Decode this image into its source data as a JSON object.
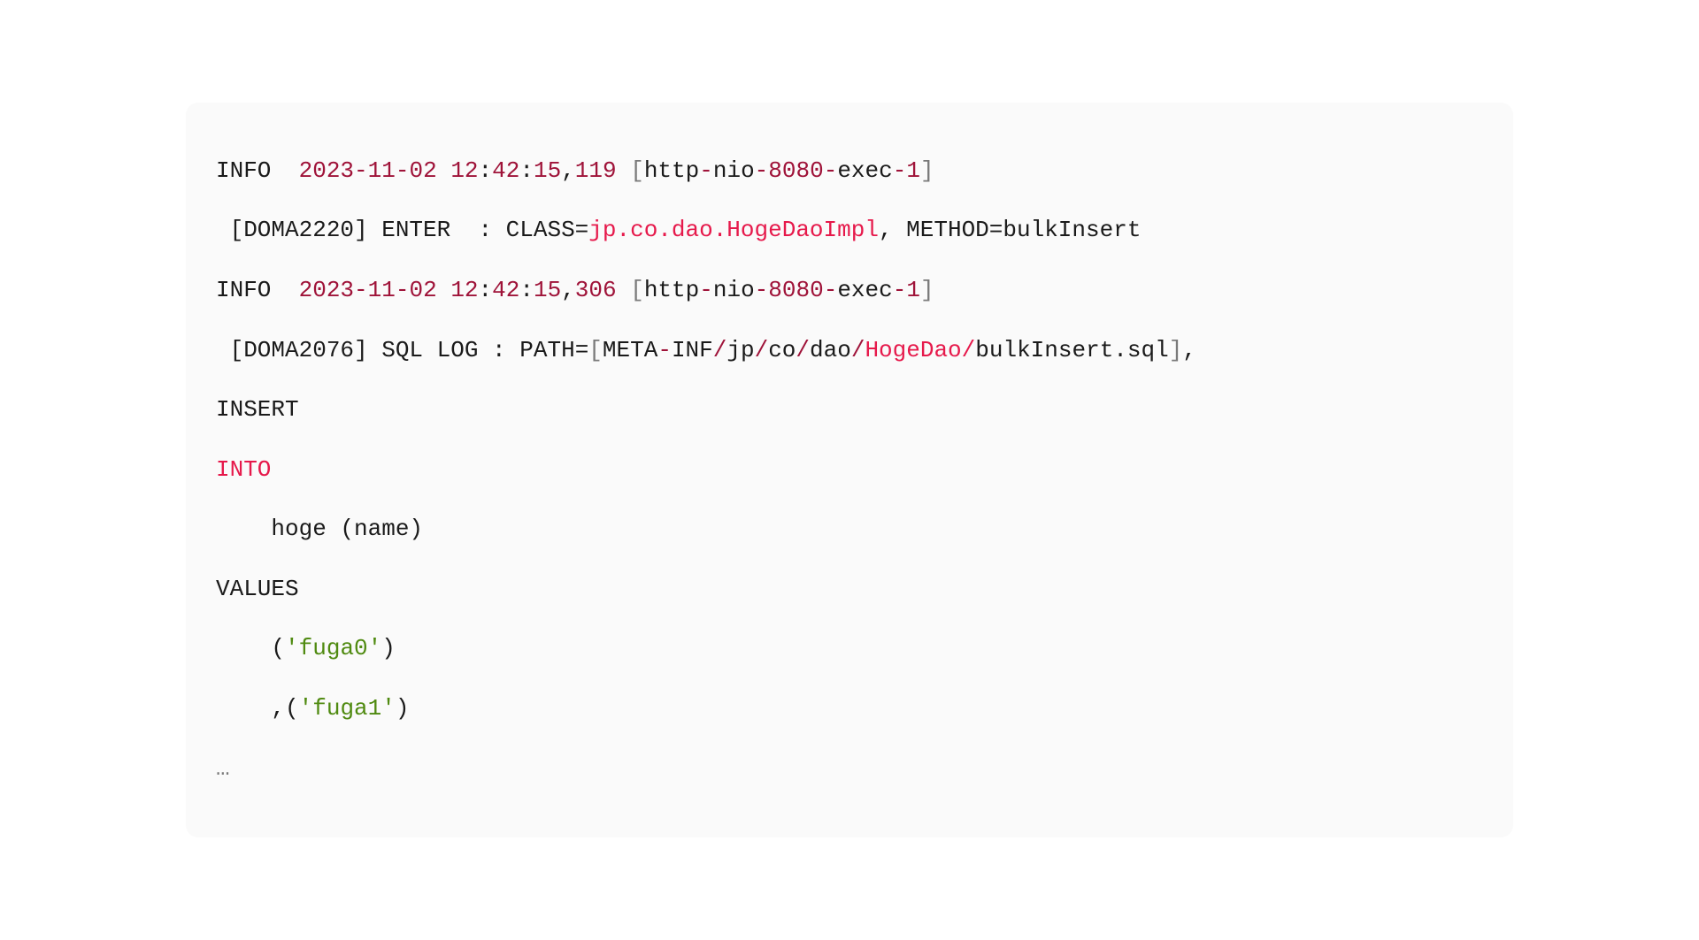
{
  "log": {
    "line1": {
      "level": "INFO  ",
      "date": "2023",
      "dash1": "-",
      "mon": "11",
      "dash2": "-",
      "day": "02",
      "sp1": " ",
      "hh": "12",
      "colon1": ":",
      "mm": "42",
      "colon2": ":",
      "ss": "15",
      "comma": ",",
      "ms": "119",
      "sp2": " ",
      "lb": "[",
      "thr1": "http",
      "thr_dash1": "-",
      "thr2": "nio",
      "thr_dash2": "-",
      "thr_port": "8080",
      "thr_dash3": "-",
      "thr3": "exec",
      "thr_dash4": "-",
      "thr_n": "1",
      "rb": "]"
    },
    "line2": {
      "pre": " [DOMA2220] ENTER  : ",
      "class_label": "CLASS",
      "eq1": "=",
      "class_val": "jp.co.dao.HogeDaoImpl",
      "comma": ", ",
      "method_label": "METHOD",
      "eq2": "=",
      "method_val": "bulkInsert"
    },
    "line3": {
      "level": "INFO  ",
      "date": "2023",
      "dash1": "-",
      "mon": "11",
      "dash2": "-",
      "day": "02",
      "sp1": " ",
      "hh": "12",
      "colon1": ":",
      "mm": "42",
      "colon2": ":",
      "ss": "15",
      "comma": ",",
      "ms": "306",
      "sp2": " ",
      "lb": "[",
      "thr1": "http",
      "thr_dash1": "-",
      "thr2": "nio",
      "thr_dash2": "-",
      "thr_port": "8080",
      "thr_dash3": "-",
      "thr3": "exec",
      "thr_dash4": "-",
      "thr_n": "1",
      "rb": "]"
    },
    "line4": {
      "pre": " [DOMA2076] SQL LOG : ",
      "path_label": "PATH",
      "eq": "=",
      "lb": "[",
      "p1": "META",
      "dash": "-",
      "p2": "INF",
      "sl1": "/",
      "p3": "jp",
      "sl2": "/",
      "p4": "co",
      "sl3": "/",
      "p5": "dao",
      "sl4": "/",
      "p6": "HogeDao",
      "sl5": "/",
      "p7": "bulkInsert",
      "dot": ".",
      "ext": "sql",
      "rb": "]",
      "comma": ","
    },
    "sql": {
      "insert": "INSERT",
      "into": "INTO",
      "table_indent": "    hoge (name)",
      "values": "VALUES",
      "v1_indent": "    ",
      "v1_lp": "(",
      "v1_str": "'fuga0'",
      "v1_rp": ")",
      "v2_indent": "    ",
      "v2_comma": ",",
      "v2_lp": "(",
      "v2_str": "'fuga1'",
      "v2_rp": ")"
    },
    "ellipsis": "…"
  }
}
